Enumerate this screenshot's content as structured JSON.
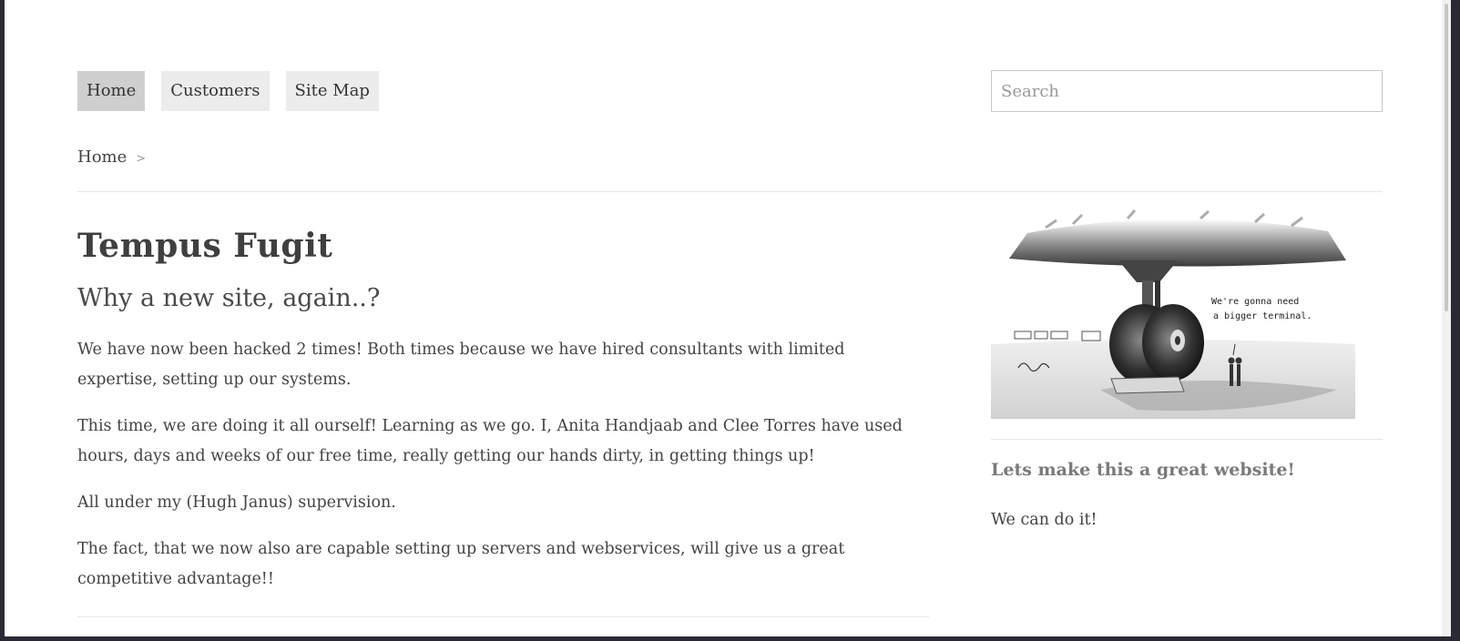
{
  "nav": {
    "items": [
      {
        "label": "Home",
        "active": true
      },
      {
        "label": "Customers",
        "active": false
      },
      {
        "label": "Site Map",
        "active": false
      }
    ]
  },
  "search": {
    "placeholder": "Search",
    "value": ""
  },
  "breadcrumb": {
    "home": "Home",
    "separator": ">"
  },
  "article": {
    "title": "Tempus Fugit",
    "subtitle": "Why a new site, again..?",
    "paragraphs": [
      "We have now been hacked 2 times! Both times because we have hired consultants with limited expertise, setting up our systems.",
      "This time, we are doing it all ourself! Learning as we go. I, Anita Handjaab and Clee Torres have used hours, days and weeks of our free time, really getting our hands dirty, in getting things up!",
      "All under my (Hugh Janus) supervision.",
      "The fact, that we now also are capable setting up servers and webservices, will give us a great competitive advantage!!"
    ]
  },
  "sidebar": {
    "cartoon_caption_line1": "We're gonna need",
    "cartoon_caption_line2": "a bigger terminal.",
    "heading": "Lets make this a great website!",
    "text": "We can do it!"
  }
}
